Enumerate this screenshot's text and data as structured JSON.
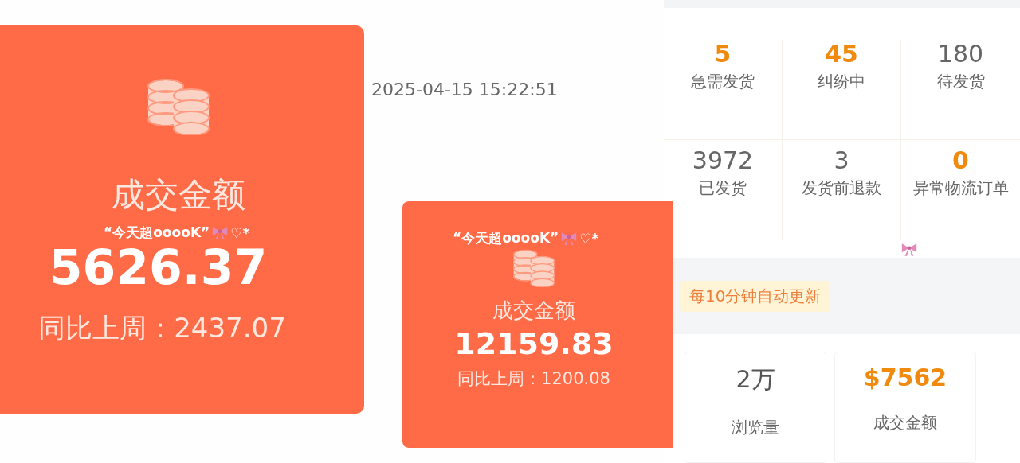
{
  "big_card": {
    "title": "成交金额",
    "value": "5626.37",
    "comparison": "同比上周：2437.07"
  },
  "timestamp": "2025-04-15 15:22:51",
  "small_card": {
    "title": "成交金额",
    "value": "12159.83",
    "comparison": "同比上周：1200.08"
  },
  "order_stats": [
    {
      "value": "5",
      "label": "急需发货",
      "highlight": true
    },
    {
      "value": "45",
      "label": "纠纷中",
      "highlight": true
    },
    {
      "value": "180",
      "label": "待发货",
      "highlight": false
    },
    {
      "value": "3972",
      "label": "已发货",
      "highlight": false
    },
    {
      "value": "3",
      "label": "发货前退款",
      "highlight": false
    },
    {
      "value": "0",
      "label": "异常物流订单",
      "highlight": true
    }
  ],
  "update_badge": "每10分钟自动更新",
  "metrics": [
    {
      "value": "2万",
      "label": "浏览量",
      "highlight": false
    },
    {
      "value": "$7562",
      "label": "成交金额",
      "highlight": true
    }
  ],
  "captions": [
    {
      "text": "“今天超ooooK”",
      "suffix": "♡*"
    },
    {
      "text": "“今天超ooooK”",
      "suffix": "♡*"
    }
  ]
}
